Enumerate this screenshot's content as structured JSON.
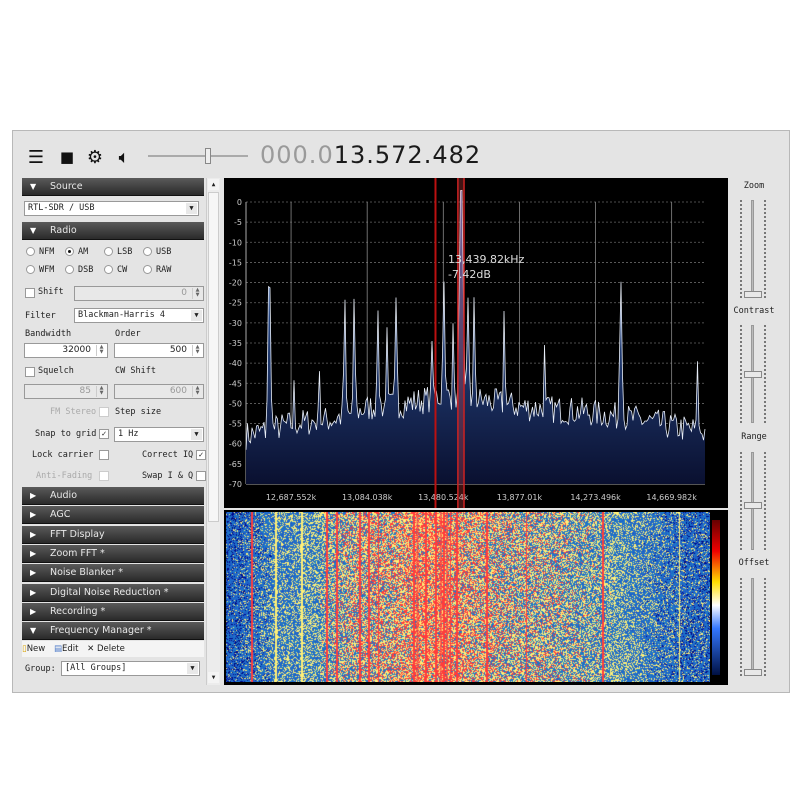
{
  "toolbar": {
    "icons": [
      "menu-icon",
      "stop-icon",
      "gear-icon",
      "speaker-icon"
    ],
    "volume_level": 0.6,
    "frequency_dim": "000.0",
    "frequency_bright": "13.572.482"
  },
  "source": {
    "header": "Source",
    "device": "RTL-SDR / USB"
  },
  "radio": {
    "header": "Radio",
    "modes": [
      {
        "label": "NFM",
        "selected": false
      },
      {
        "label": "AM",
        "selected": true
      },
      {
        "label": "LSB",
        "selected": false
      },
      {
        "label": "USB",
        "selected": false
      },
      {
        "label": "WFM",
        "selected": false
      },
      {
        "label": "DSB",
        "selected": false
      },
      {
        "label": "CW",
        "selected": false
      },
      {
        "label": "RAW",
        "selected": false
      }
    ],
    "shift_label": "Shift",
    "shift_value": "0",
    "filter_label": "Filter",
    "filter_value": "Blackman-Harris 4",
    "bandwidth_label": "Bandwidth",
    "bandwidth_value": "32000",
    "order_label": "Order",
    "order_value": "500",
    "squelch_label": "Squelch",
    "squelch_value": "85",
    "cw_shift_label": "CW Shift",
    "cw_shift_value": "600",
    "fm_stereo_label": "FM Stereo",
    "step_size_label": "Step size",
    "snap_label": "Snap to grid",
    "snap_checked": true,
    "step_value": "1 Hz",
    "lock_carrier_label": "Lock carrier",
    "correct_iq_label": "Correct IQ",
    "correct_iq_checked": true,
    "anti_fading_label": "Anti-Fading",
    "swap_iq_label": "Swap I & Q"
  },
  "panels": [
    "Audio",
    "AGC",
    "FFT Display",
    "Zoom FFT *",
    "Noise Blanker *",
    "Digital Noise Reduction *",
    "Recording *"
  ],
  "freq_manager": {
    "header": "Frequency Manager *",
    "new_label": "New",
    "edit_label": "Edit",
    "delete_label": "Delete",
    "group_label": "Group:",
    "group_value": "[All Groups]"
  },
  "sliders": {
    "zoom_label": "Zoom",
    "contrast_label": "Contrast",
    "range_label": "Range",
    "offset_label": "Offset",
    "zoom": 0.0,
    "contrast": 0.5,
    "range": 0.45,
    "offset": 0.0
  },
  "chart_data": {
    "type": "line",
    "xlim_khz": [
      12452.8,
      14843.7
    ],
    "ylim_db": [
      -70,
      0
    ],
    "yticks": [
      "0",
      "-5",
      "-10",
      "-15",
      "-20",
      "-25",
      "-30",
      "-35",
      "-40",
      "-45",
      "-50",
      "-55",
      "-60",
      "-65",
      "-70"
    ],
    "xticks": [
      {
        "khz": 12687.552,
        "label": "12,687.552k"
      },
      {
        "khz": 13084.038,
        "label": "13,084.038k"
      },
      {
        "khz": 13480.524,
        "label": "13,480.524k"
      },
      {
        "khz": 13877.01,
        "label": "13,877.01k"
      },
      {
        "khz": 14273.496,
        "label": "14,273.496k"
      },
      {
        "khz": 14669.982,
        "label": "14,669.982k"
      }
    ],
    "grid": true,
    "noise_floor": [
      [
        12452.8,
        -58
      ],
      [
        12700,
        -55
      ],
      [
        12900,
        -54
      ],
      [
        13100,
        -51
      ],
      [
        13300,
        -50
      ],
      [
        13480,
        -48
      ],
      [
        13650,
        -49
      ],
      [
        13900,
        -51
      ],
      [
        14200,
        -52
      ],
      [
        14500,
        -54
      ],
      [
        14700,
        -56
      ],
      [
        14843.7,
        -57
      ]
    ],
    "peaks": [
      [
        12574,
        -27
      ],
      [
        12701,
        -47
      ],
      [
        12837,
        -44
      ],
      [
        12966,
        -28
      ],
      [
        13018,
        -28
      ],
      [
        13139,
        -29
      ],
      [
        13186,
        -33
      ],
      [
        13235,
        -25
      ],
      [
        13418,
        -40
      ],
      [
        13482,
        -23
      ],
      [
        13533,
        -33
      ],
      [
        13574,
        -3
      ],
      [
        13609,
        -24
      ],
      [
        13644,
        -29
      ],
      [
        13800,
        -32
      ],
      [
        14006,
        -38
      ],
      [
        14404,
        -23
      ],
      [
        14801,
        -45
      ]
    ],
    "cursor_line_khz": 13439.82,
    "filter_khz": 13572.482,
    "filter_bandwidth_khz": 32,
    "cursor_label_freq": "13,439.82kHz",
    "cursor_label_db": "-7.42dB"
  }
}
